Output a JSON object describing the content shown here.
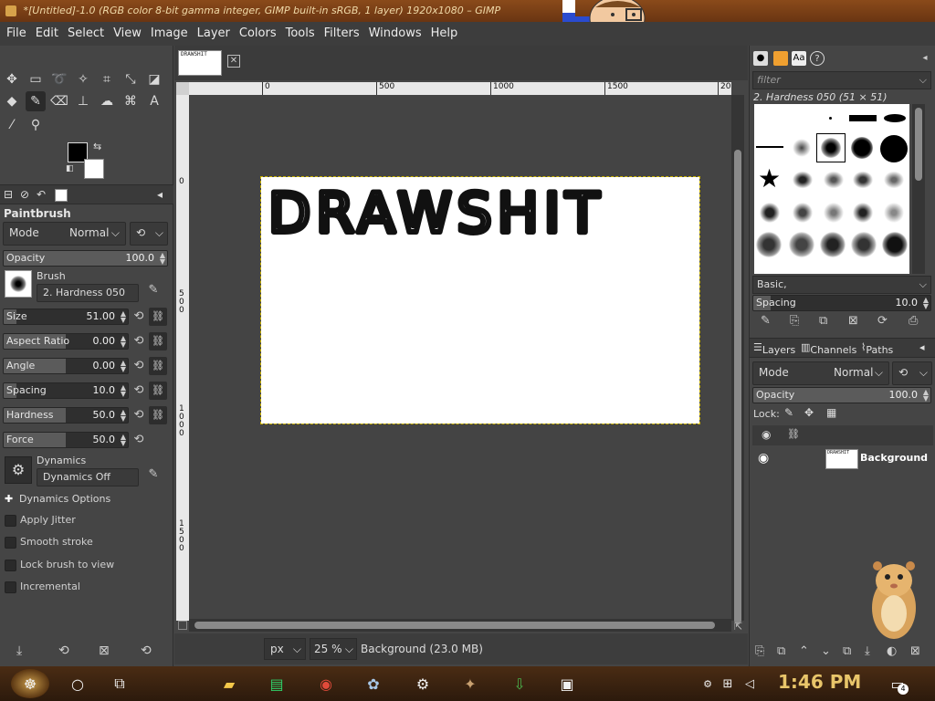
{
  "window": {
    "title": "*[Untitled]-1.0 (RGB color 8-bit gamma integer, GIMP built-in sRGB, 1 layer) 1920x1080 – GIMP"
  },
  "menu": [
    "File",
    "Edit",
    "Select",
    "View",
    "Image",
    "Layer",
    "Colors",
    "Tools",
    "Filters",
    "Windows",
    "Help"
  ],
  "tool_options": {
    "tool_name": "Paintbrush",
    "mode_label": "Mode",
    "mode_value": "Normal",
    "opacity": {
      "label": "Opacity",
      "value": "100.0",
      "fraction": 1.0
    },
    "brush_label": "Brush",
    "brush_value": "2. Hardness 050",
    "size": {
      "label": "Size",
      "value": "51.00",
      "fraction": 0.1
    },
    "aspect_ratio": {
      "label": "Aspect Ratio",
      "value": "0.00",
      "fraction": 0.5
    },
    "angle": {
      "label": "Angle",
      "value": "0.00",
      "fraction": 0.5
    },
    "spacing": {
      "label": "Spacing",
      "value": "10.0",
      "fraction": 0.1
    },
    "hardness": {
      "label": "Hardness",
      "value": "50.0",
      "fraction": 0.5
    },
    "force": {
      "label": "Force",
      "value": "50.0",
      "fraction": 0.5
    },
    "dynamics_label": "Dynamics",
    "dynamics_value": "Dynamics Off",
    "dynamics_options": "Dynamics Options",
    "apply_jitter": "Apply Jitter",
    "smooth_stroke": "Smooth stroke",
    "lock_brush": "Lock brush to view",
    "incremental": "Incremental"
  },
  "canvas": {
    "thumbnail_text": "DRAWSHIT",
    "drawn_text": "DRAWSHIT",
    "ruler_top": [
      "0",
      "500",
      "1000",
      "1500",
      "20"
    ],
    "ruler_left": [
      "0",
      "500",
      "1000",
      "1500"
    ]
  },
  "statusbar": {
    "unit": "px",
    "zoom": "25 %",
    "status": "Background (23.0 MB)"
  },
  "brushes": {
    "filter_placeholder": "filter",
    "selected_name": "2. Hardness 050 (51 × 51)",
    "tag": "Basic,",
    "spacing_label": "Spacing",
    "spacing_value": "10.0"
  },
  "layers": {
    "tabs": [
      "Layers",
      "Channels",
      "Paths"
    ],
    "mode_label": "Mode",
    "mode_value": "Normal",
    "opacity_label": "Opacity",
    "opacity_value": "100.0",
    "lock_label": "Lock:",
    "layer_name": "Background",
    "thumb_text": "DRAWSHIT"
  },
  "taskbar": {
    "clock": "1:46 PM",
    "notification_count": "4"
  },
  "colors": {
    "titlebar": "#6a3512",
    "panel": "#454545",
    "taskbar": "#3a2210",
    "clock": "#e8c56a"
  }
}
